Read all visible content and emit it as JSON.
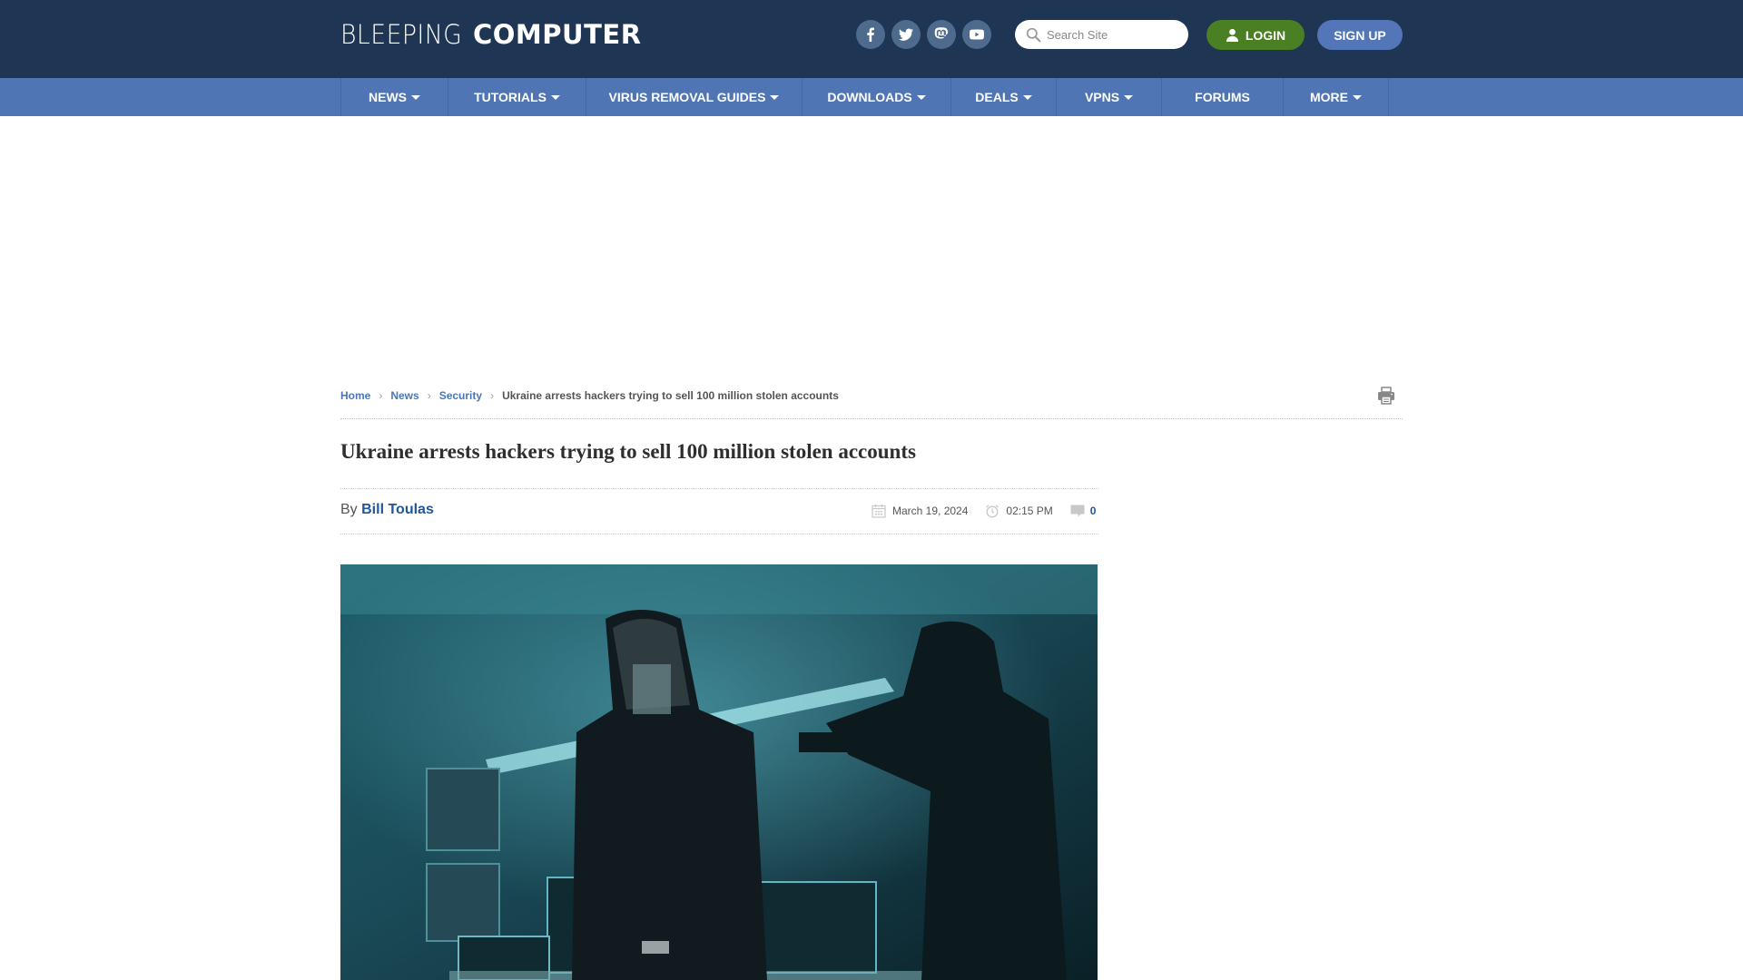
{
  "header": {
    "logo_light": "BLEEPING",
    "logo_bold": "COMPUTER",
    "socials": [
      "facebook-icon",
      "twitter-icon",
      "mastodon-icon",
      "youtube-icon"
    ],
    "search": {
      "placeholder": "Search Site",
      "value": ""
    },
    "login_label": "LOGIN",
    "signup_label": "SIGN UP",
    "colors": {
      "bg": "#1e3553",
      "login": "#4a7f23",
      "signup": "#5276b8"
    }
  },
  "nav": {
    "items": [
      {
        "label": "NEWS",
        "dropdown": true
      },
      {
        "label": "TUTORIALS",
        "dropdown": true
      },
      {
        "label": "VIRUS REMOVAL GUIDES",
        "dropdown": true
      },
      {
        "label": "DOWNLOADS",
        "dropdown": true
      },
      {
        "label": "DEALS",
        "dropdown": true
      },
      {
        "label": "VPNS",
        "dropdown": true
      },
      {
        "label": "FORUMS",
        "dropdown": false
      },
      {
        "label": "MORE",
        "dropdown": true
      }
    ],
    "color": "#5075b5"
  },
  "breadcrumb": {
    "items": [
      "Home",
      "News",
      "Security"
    ],
    "current": "Ukraine arrests hackers trying to sell 100 million stolen accounts"
  },
  "article": {
    "title": "Ukraine arrests hackers trying to sell 100 million stolen accounts",
    "by_label": "By",
    "author": "Bill Toulas",
    "date": "March 19, 2024",
    "time": "02:15 PM",
    "comments": "0",
    "image_alt": "Hooded hacker in handcuffs with armed officer in server room"
  }
}
